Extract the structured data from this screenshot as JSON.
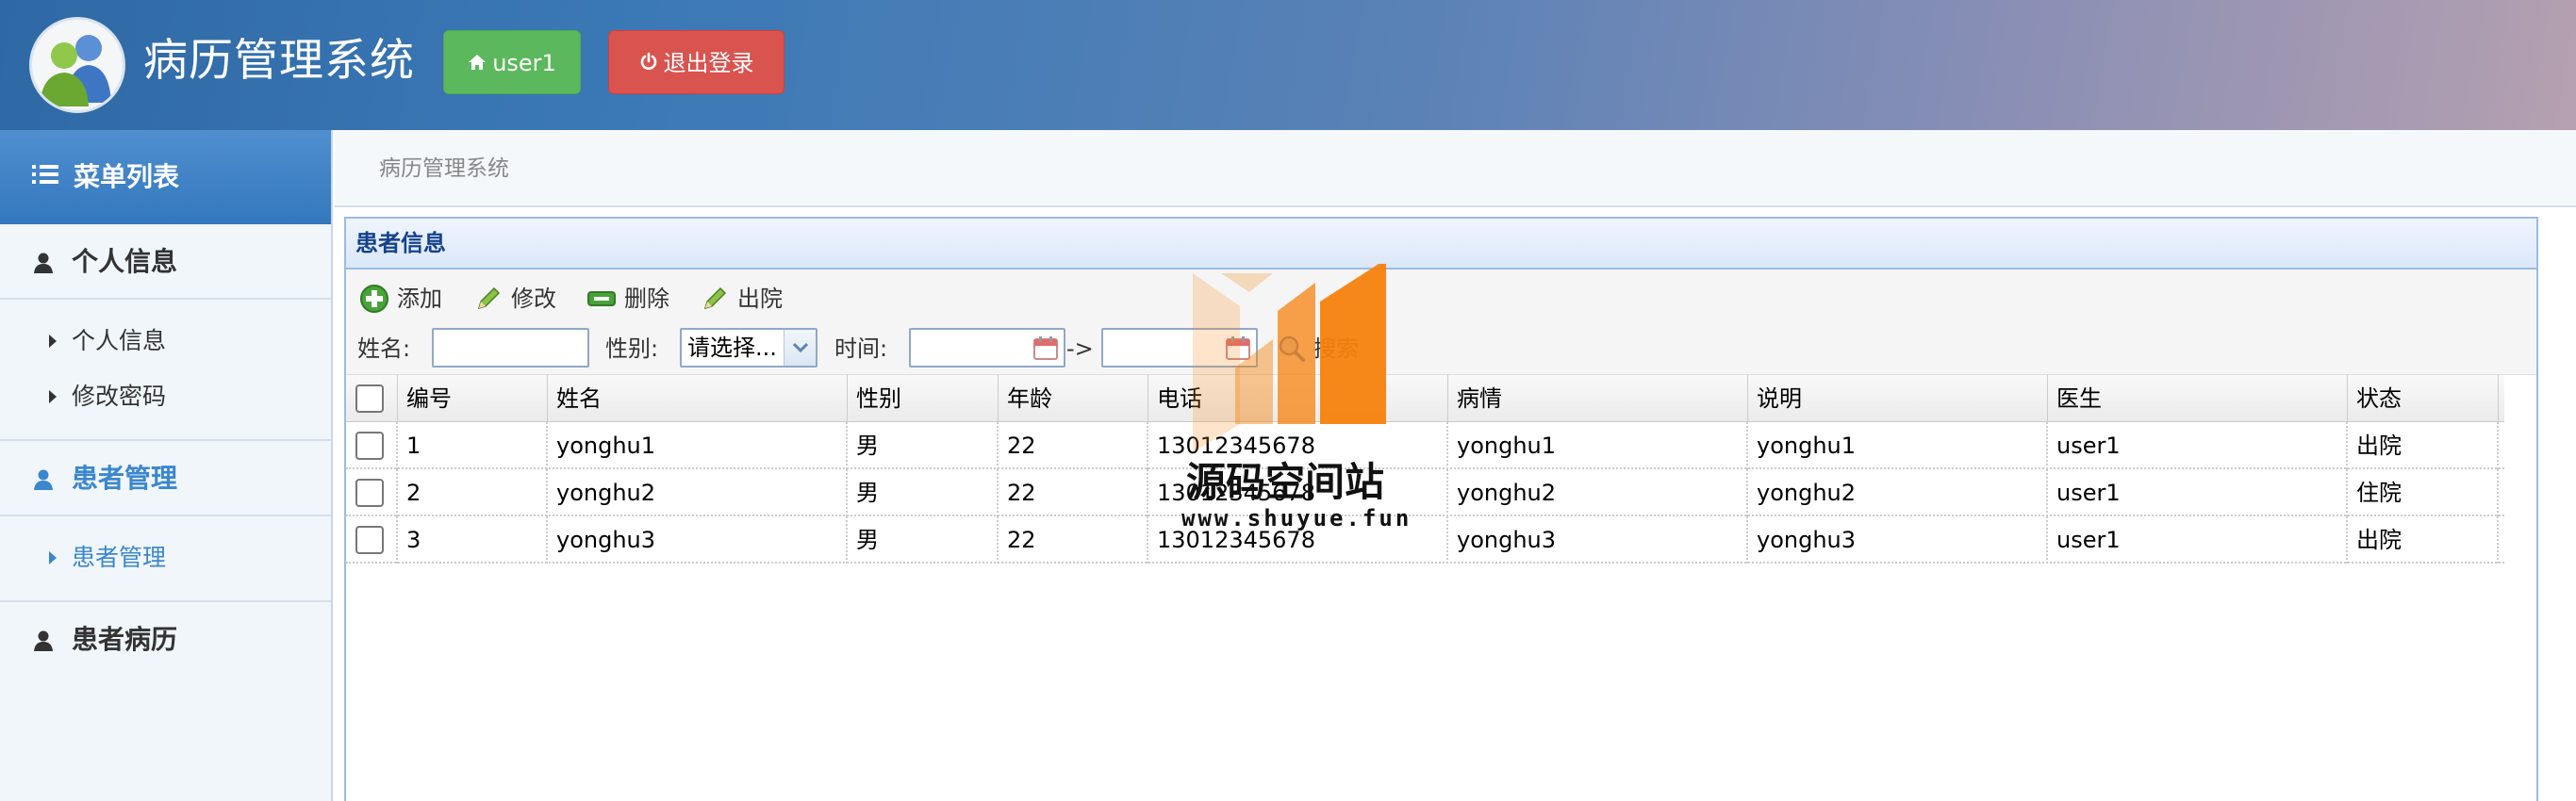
{
  "header": {
    "title": "病历管理系统",
    "user_label": "user1",
    "logout_label": "退出登录"
  },
  "sidebar": {
    "menu_title": "菜单列表",
    "groups": [
      {
        "label": "个人信息",
        "items": [
          {
            "label": "个人信息"
          },
          {
            "label": "修改密码"
          }
        ]
      },
      {
        "label": "患者管理",
        "items": [
          {
            "label": "患者管理"
          }
        ]
      },
      {
        "label": "患者病历",
        "items": []
      }
    ]
  },
  "breadcrumb": "病历管理系统",
  "panel": {
    "title": "患者信息",
    "toolbar": {
      "add": "添加",
      "edit": "修改",
      "delete": "删除",
      "discharge": "出院"
    },
    "search": {
      "name_label": "姓名:",
      "gender_label": "性别:",
      "gender_selected": "请选择...",
      "time_label": "时间:",
      "range_sep": "->",
      "search_label": "搜索"
    },
    "columns": [
      "编号",
      "姓名",
      "性别",
      "年龄",
      "电话",
      "病情",
      "说明",
      "医生",
      "状态"
    ],
    "rows": [
      [
        "1",
        "yonghu1",
        "男",
        "22",
        "13012345678",
        "yonghu1",
        "yonghu1",
        "user1",
        "出院"
      ],
      [
        "2",
        "yonghu2",
        "男",
        "22",
        "13012345678",
        "yonghu2",
        "yonghu2",
        "user1",
        "住院"
      ],
      [
        "3",
        "yonghu3",
        "男",
        "22",
        "13012345678",
        "yonghu3",
        "yonghu3",
        "user1",
        "出院"
      ]
    ]
  },
  "watermark": {
    "name": "源码空间站",
    "url": "www.shuyue.fun"
  },
  "colors": {
    "header_start": "#2f69a5",
    "success": "#5cb85c",
    "danger": "#d9534f",
    "active_link": "#3a87ce",
    "panel_title": "#15428b",
    "watermark_orange": "#f5820d"
  }
}
